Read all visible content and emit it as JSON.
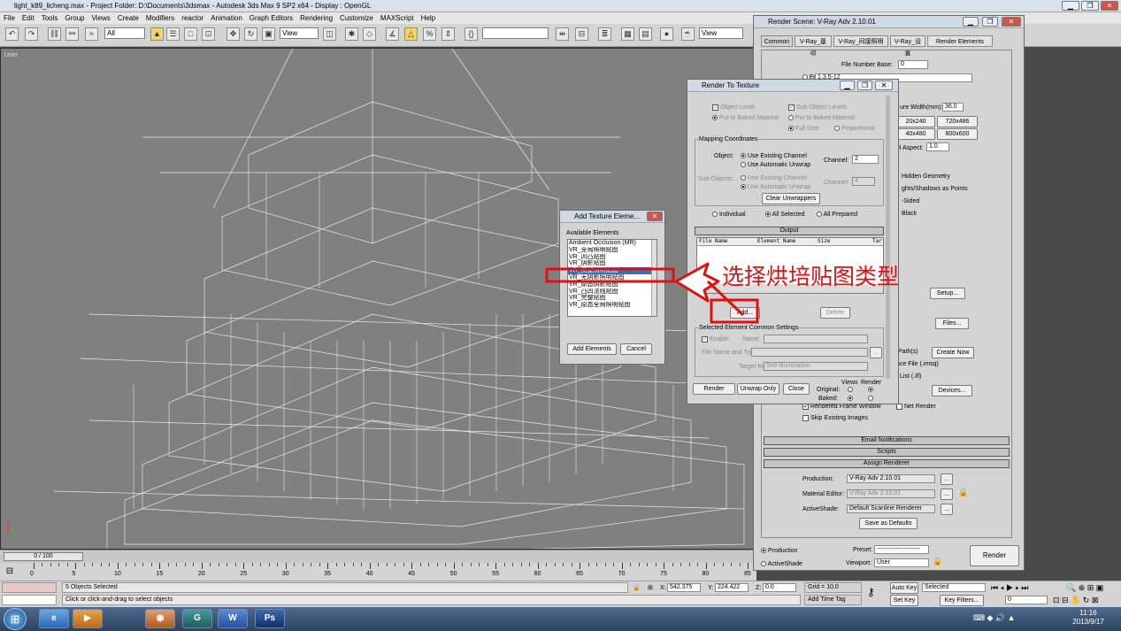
{
  "app": {
    "title": "light_k89_licheng.max     - Project Folder: D:\\Documents\\3dsmax     - Autodesk 3ds Max 9 SP2 x64     - Display : OpenGL"
  },
  "menu": [
    "File",
    "Edit",
    "Tools",
    "Group",
    "Views",
    "Create",
    "Modifiers",
    "reactor",
    "Animation",
    "Graph Editors",
    "Rendering",
    "Customize",
    "MAXScript",
    "Help"
  ],
  "toolbar": {
    "selection_filter": "All",
    "ref_coord": "View",
    "named_sel": "",
    "render_view": "View"
  },
  "viewport": {
    "label": "User"
  },
  "render_scene": {
    "title": "Render Scene: V-Ray Adv 2.10.01",
    "tabs": [
      "Common",
      "V-Ray_基项",
      "V-Ray_间接照明",
      "V-Ray_设置",
      "Render Elements"
    ],
    "file_number_base_label": "File Number Base:",
    "file_number_base_value": "0",
    "frames_label": "Frames",
    "frames_value": "1,3,5-12",
    "aperture_label": "ure Width(mm):",
    "aperture_value": "36.0",
    "res_buttons": [
      "20x240",
      "720x486",
      "40x480",
      "800x600"
    ],
    "pixel_aspect_label": "el Aspect:",
    "pixel_aspect_value": "1.0",
    "options": [
      "Hidden Geometry",
      "ghts/Shadows as Points",
      "-Sided",
      "Black"
    ],
    "setup_btn": "Setup...",
    "files_btn": "Files...",
    "path_label": "Path(s)",
    "create_now_btn": "Create Now",
    "mesq_label": "nce File (.imsq)",
    "ifl_label": "List (.ifl)",
    "devices_btn": "Devices...",
    "rendered_frame_window": "Rendered Frame Window",
    "net_render": "Net Render",
    "skip_existing": "Skip Existing Images",
    "rollouts": [
      "Email Notifications",
      "Scripts",
      "Assign Renderer"
    ],
    "production_label": "Production:",
    "production_value": "V-Ray Adv 2.10.01",
    "material_editor_label": "Material Editor:",
    "material_editor_value": "V-Ray Adv 2.10.01",
    "activeshade_label": "ActiveShade:",
    "activeshade_value": "Default Scanline Renderer",
    "save_defaults_btn": "Save as Defaults",
    "production_radio": "Production",
    "activeshade_radio": "ActiveShade",
    "preset_label": "Preset:",
    "preset_value": "---------------------",
    "viewport_label": "Viewport:",
    "viewport_value": "User",
    "render_btn": "Render",
    "ellipsis": "..."
  },
  "render_to_texture": {
    "title": "Render To Texture",
    "object_level": "Object Level",
    "sub_object_levels": "Sub-Object Levels",
    "put_to_baked": "Put to Baked Material",
    "put_to_baked_2": "Put to Baked Material",
    "full_size": "Full Size",
    "proportional": "Proportional",
    "mapping_coords": "Mapping Coordinates",
    "object_label": "Object:",
    "use_existing": "Use Existing Channel",
    "use_auto_unwrap": "Use Automatic Unwrap",
    "channel_label": "Channel:",
    "channel_value": "2",
    "subobjects_label": "Sub-Objects:",
    "use_existing_2": "Use Existing Channel",
    "use_auto_unwrap_2": "Use Automatic Unwrap",
    "channel_label_2": "Channel:",
    "channel_value_2": "4",
    "clear_unwrappers": "Clear Unwrappers",
    "individual": "Individual",
    "all_selected": "All Selected",
    "all_prepared": "All Prepared",
    "output_rollout": "Output",
    "columns": [
      "File Name",
      "Element Name",
      "Size",
      "Tar"
    ],
    "add_btn": "Add...",
    "delete_btn": "Delete",
    "sel_element_settings": "Selected Element Common Settings",
    "enable": "Enable",
    "name_label": "Name:",
    "file_name_type": "File Name and Type:",
    "target_map_slot": "Target Map Slot:",
    "target_map_value": "Self-Illumination",
    "views_label": "Views",
    "render_label": "Render",
    "original_label": "Original:",
    "baked_label": "Baked:",
    "render_btn": "Render",
    "unwrap_only_btn": "Unwrap Only",
    "close_btn": "Close"
  },
  "add_texture": {
    "title": "Add Texture Eleme...",
    "available_label": "Available Elements",
    "items": [
      "Ambient Occlusion (MR)",
      "VR_全局照明贴图",
      "VR_凹凸贴图",
      "VR_阴影贴图",
      "VR_完整照明贴图",
      "VR_无阴影照明贴图",
      "VR_原态阴影贴图",
      "VR_凸凹法线贴图",
      "VR_完整贴图",
      "VR_原态全局照明贴图"
    ],
    "selected_index": 4,
    "add_elements_btn": "Add Elements",
    "cancel_btn": "Cancel"
  },
  "annotation": {
    "text": "选择烘培贴图类型",
    "color": "#e01010"
  },
  "timeline": {
    "frame": "0 / 100",
    "ticks": [
      "0",
      "5",
      "10",
      "15",
      "20",
      "25",
      "30",
      "35",
      "40",
      "45",
      "50",
      "55",
      "60",
      "65",
      "70",
      "75",
      "80",
      "85"
    ]
  },
  "status": {
    "selected": "5 Objects Selected",
    "prompt": "Click or click-and-drag to select objects",
    "x_label": "X:",
    "x_value": "542.375",
    "y_label": "Y:",
    "y_value": "224.422",
    "z_label": "Z:",
    "z_value": "0.0",
    "grid": "Grid = 10.0",
    "add_time_tag": "Add Time Tag",
    "auto_key": "Auto Key",
    "set_key": "Set Key",
    "key_set": "Selected",
    "key_filters": "Key Filters...",
    "frame_value": "0"
  },
  "clock": {
    "time": "11:16",
    "date": "2013/9/17"
  },
  "taskbar": [
    "IE",
    "Media",
    "3dsmax",
    "Word",
    "PS"
  ]
}
